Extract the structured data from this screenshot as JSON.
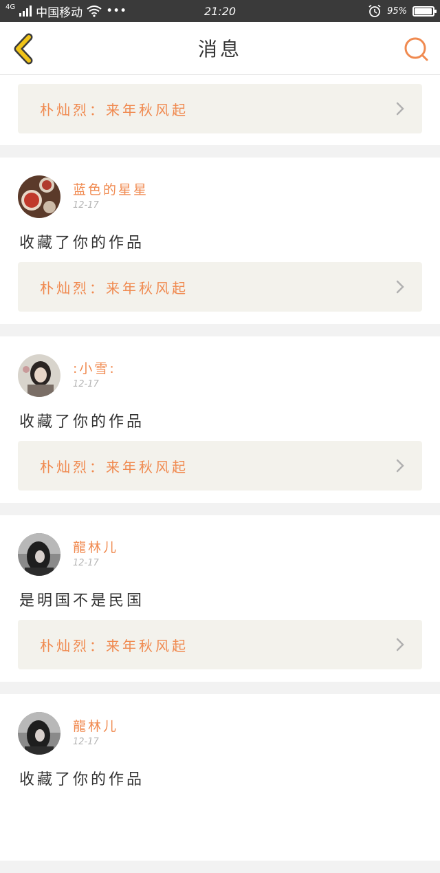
{
  "status_bar": {
    "network": "4G",
    "carrier": "中国移动",
    "more": "•••",
    "time": "21:20",
    "battery_text": "95%",
    "battery_level": 0.95
  },
  "header": {
    "title": "消息",
    "back_icon": "chevron-left-icon",
    "search_icon": "search-icon"
  },
  "colors": {
    "accent": "#f08a50",
    "ref_bg": "#f3f2ec"
  },
  "top_card": {
    "ref_text": "朴灿烈：来年秋风起"
  },
  "messages": [
    {
      "username": "蓝色的星星",
      "time": "12-17",
      "comment": "收藏了你的作品",
      "ref_text": "朴灿烈：来年秋风起"
    },
    {
      "username": ":小雪:",
      "time": "12-17",
      "comment": "收藏了你的作品",
      "ref_text": "朴灿烈：来年秋风起"
    },
    {
      "username": "龍林儿",
      "time": "12-17",
      "comment": "是明国不是民国",
      "ref_text": "朴灿烈：来年秋风起"
    },
    {
      "username": "龍林儿",
      "time": "12-17",
      "comment": "收藏了你的作品"
    }
  ]
}
